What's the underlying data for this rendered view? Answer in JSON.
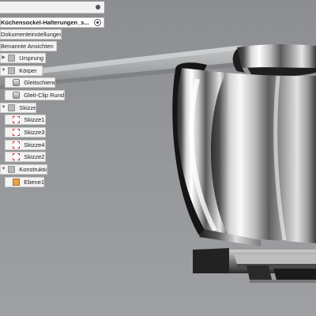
{
  "browser": {
    "document_title": "Küchensockel-Halterungen_s...",
    "items": [
      {
        "label": "Dokumenteinstellungen",
        "icon": "gear-folder-icon"
      },
      {
        "label": "Benannte Ansichten",
        "icon": "folder-icon"
      },
      {
        "label": "Ursprung",
        "icon": "folder-icon"
      },
      {
        "label": "Körper",
        "icon": "folder-icon"
      },
      {
        "label": "Gleitschiene",
        "icon": "body-icon"
      },
      {
        "label": "Gleit-Clip Rund",
        "icon": "body-icon"
      },
      {
        "label": "Skizzen",
        "icon": "folder-icon"
      },
      {
        "label": "Skizze1",
        "icon": "sketch-icon"
      },
      {
        "label": "Skizze3",
        "icon": "sketch-icon"
      },
      {
        "label": "Skizze4",
        "icon": "sketch-icon"
      },
      {
        "label": "Skizze2",
        "icon": "sketch-icon"
      },
      {
        "label": "Konstruktion",
        "icon": "folder-icon"
      },
      {
        "label": "Ebene1",
        "icon": "construction-plane-icon"
      }
    ]
  },
  "colors": {
    "viewport_background": "#929497",
    "panel_background": "#f4f4f4",
    "sketch_red": "#e23b3b",
    "plane_orange": "#e9a24a"
  }
}
